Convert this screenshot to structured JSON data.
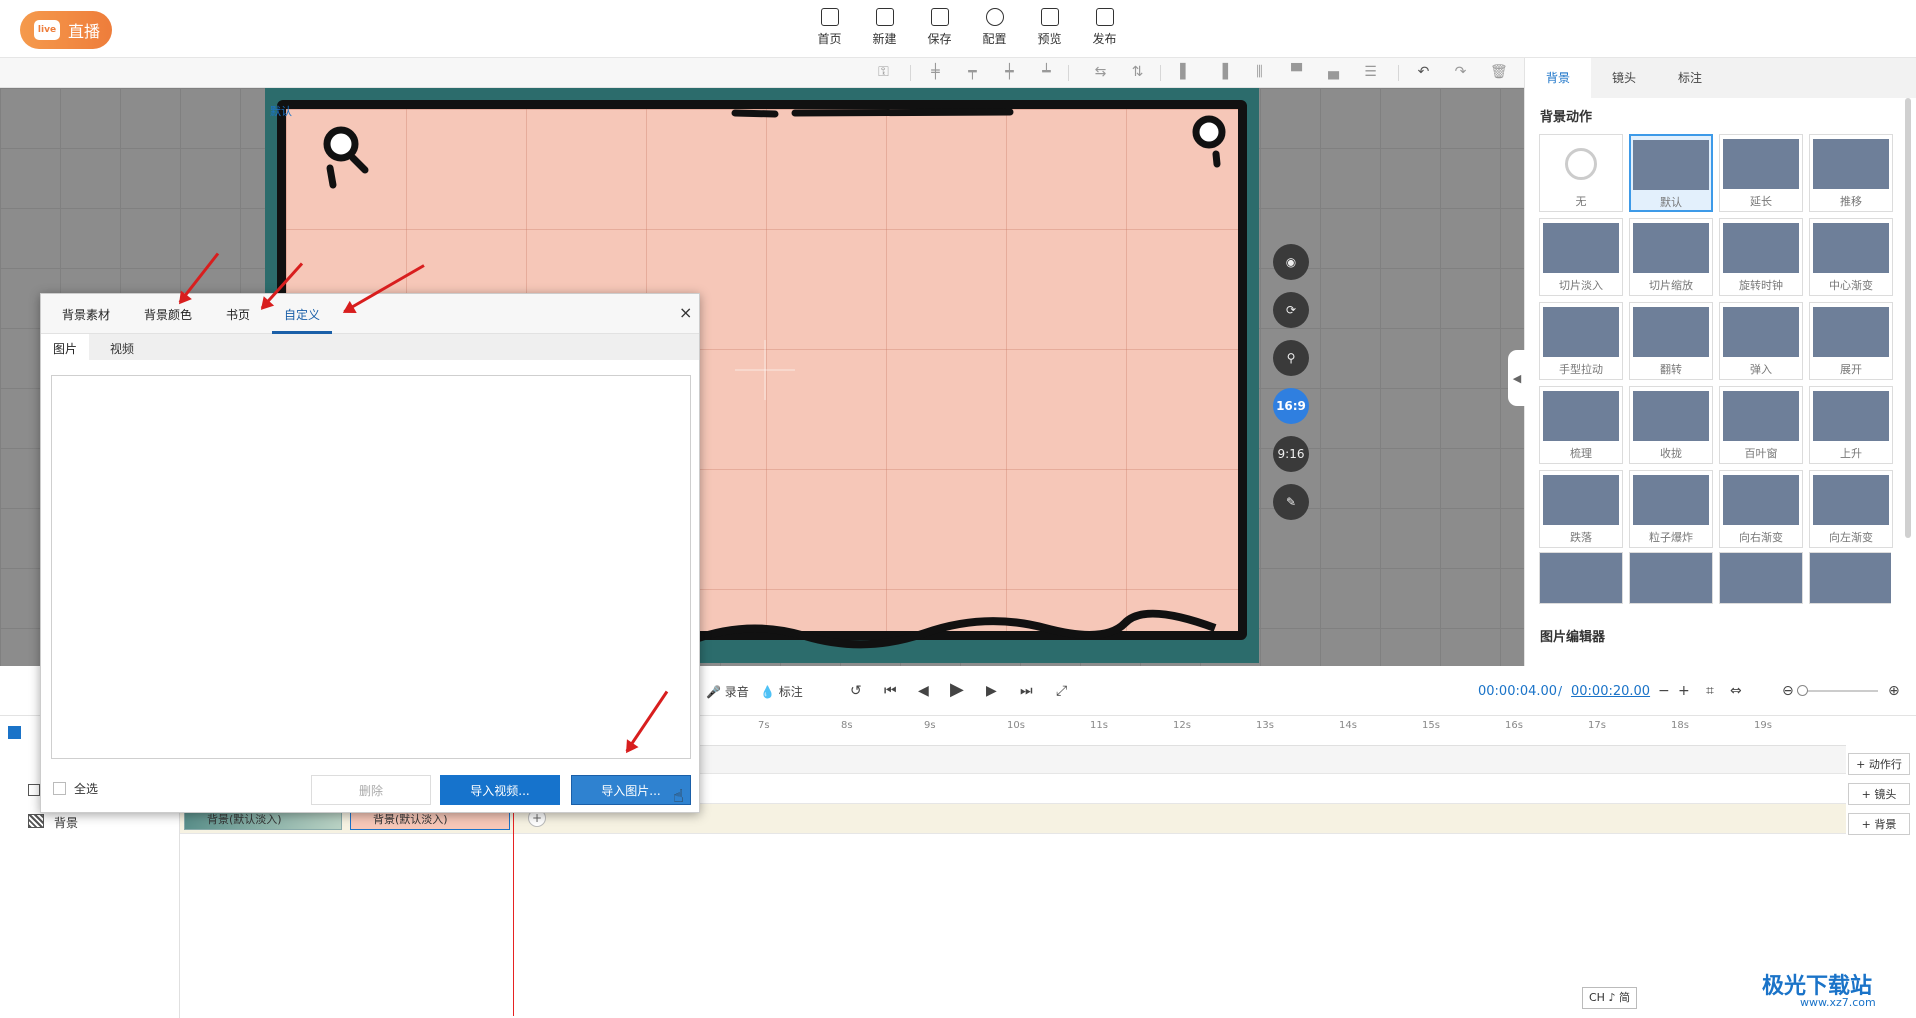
{
  "topbar": {
    "live_label": "直播",
    "live_badge": "live",
    "nav": [
      {
        "label": "首页",
        "icon": "home-icon"
      },
      {
        "label": "新建",
        "icon": "new-file-icon"
      },
      {
        "label": "保存",
        "icon": "save-icon"
      },
      {
        "label": "配置",
        "icon": "gear-icon"
      },
      {
        "label": "预览",
        "icon": "preview-icon"
      },
      {
        "label": "发布",
        "icon": "publish-icon"
      }
    ]
  },
  "canvas": {
    "stage_label": "默认",
    "ratio_active": "16:9",
    "ratio_other": "9:16"
  },
  "right_panel": {
    "tabs": [
      "背景",
      "镜头",
      "标注"
    ],
    "active_tab": "背景",
    "section_title": "背景动作",
    "animations": [
      "无",
      "默认",
      "延长",
      "推移",
      "切片淡入",
      "切片缩放",
      "旋转时钟",
      "中心渐变",
      "手型拉动",
      "翻转",
      "弹入",
      "展开",
      "梳理",
      "收拢",
      "百叶窗",
      "上升",
      "跌落",
      "粒子爆炸",
      "向右渐变",
      "向左渐变"
    ],
    "selected_animation": "默认",
    "editor_title": "图片编辑器"
  },
  "playbar": {
    "record_label": "录音",
    "annotate_label": "标注",
    "time_current": "00:00:04.00",
    "time_separator": "/",
    "time_total": "00:00:20.00"
  },
  "timeline": {
    "ticks": [
      "7s",
      "8s",
      "9s",
      "10s",
      "11s",
      "12s",
      "13s",
      "14s",
      "15s",
      "16s",
      "17s",
      "18s",
      "19s"
    ],
    "track_bg_label": "背景",
    "clip1_label": "背景(默认淡入)",
    "clip2_label": "背景(默认淡入)",
    "side_buttons": [
      "+ 动作行",
      "+ 镜头",
      "+ 背景"
    ]
  },
  "modal": {
    "tabs": [
      "背景素材",
      "背景颜色",
      "书页",
      "自定义"
    ],
    "active_tab": "自定义",
    "close": "×",
    "sub_tabs": [
      "图片",
      "视频"
    ],
    "select_all": "全选",
    "delete": "删除",
    "import_video": "导入视频...",
    "import_image": "导入图片..."
  },
  "status": {
    "ime": "CH ♪ 简",
    "watermark": "极光下载站",
    "watermark_url": "www.xz7.com"
  },
  "colors": {
    "accent": "#1a73c8",
    "live_orange": "#ee7d3b",
    "arrow_red": "#d81e1e",
    "paper_pink": "#f6c7b8"
  }
}
